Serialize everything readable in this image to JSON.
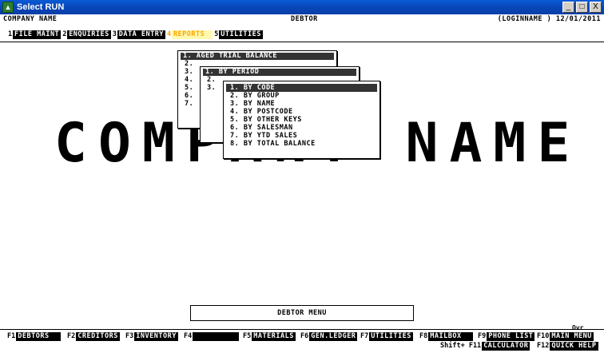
{
  "window": {
    "title": "Select RUN",
    "icon": "app-icon",
    "buttons": {
      "minimize": "_",
      "maximize": "□",
      "close": "X"
    }
  },
  "status": {
    "company": "COMPANY NAME",
    "module": "DEBTOR",
    "login": "(LOGINNAME ) 12/01/2011"
  },
  "menubar": [
    {
      "num": "1",
      "label": "FILE MAINT",
      "active": false
    },
    {
      "num": "2",
      "label": "ENQUIRIES",
      "active": false
    },
    {
      "num": "3",
      "label": "DATA ENTRY",
      "active": false
    },
    {
      "num": "4",
      "label": "REPORTS",
      "active": true
    },
    {
      "num": "5",
      "label": "UTILITIES",
      "active": false
    }
  ],
  "big_text": "COMPANY NAME",
  "popup1": {
    "title": "1. AGED TRIAL BALANCE",
    "rows": [
      "2.",
      "3.",
      "4.",
      "5.",
      "6.",
      "7."
    ]
  },
  "popup2": {
    "title": "1. BY PERIOD",
    "rows": [
      "2.",
      "3."
    ]
  },
  "popup3": {
    "selected": "1. BY CODE",
    "rows": [
      "2. BY GROUP",
      "3. BY NAME",
      "4. BY POSTCODE",
      "5. BY OTHER KEYS",
      "6. BY SALESMAN",
      "7. BY YTD SALES",
      "8. BY TOTAL BALANCE"
    ]
  },
  "footer_title": "DEBTOR MENU",
  "ovr": "Ovr",
  "fkeys": {
    "f1": {
      "key": "F1",
      "label": " DEBTORS"
    },
    "f2": {
      "key": "F2",
      "label": "CREDITORS"
    },
    "f3": {
      "key": "F3",
      "label": "INVENTORY"
    },
    "f4": {
      "key": "F4",
      "label": ""
    },
    "f5": {
      "key": "F5",
      "label": "MATERIALS"
    },
    "f6": {
      "key": "F6",
      "label": "GEN.LEDGER"
    },
    "f7": {
      "key": "F7",
      "label": "UTILITIES"
    },
    "f8": {
      "key": "F8",
      "label": " MAILBOX"
    },
    "f9": {
      "key": "F9",
      "label": "PHONE LIST"
    },
    "f10": {
      "key": "F10",
      "label": "MAIN MENU"
    },
    "shift": {
      "key": "Shift+ F11",
      "label": "CALCULATOR"
    },
    "f12": {
      "key": "F12",
      "label": "QUICK HELP"
    }
  },
  "colors": {
    "titlebar": "#0846b8",
    "active_menu_text": "#ffa500",
    "active_menu_bg": "#fff9b0"
  }
}
